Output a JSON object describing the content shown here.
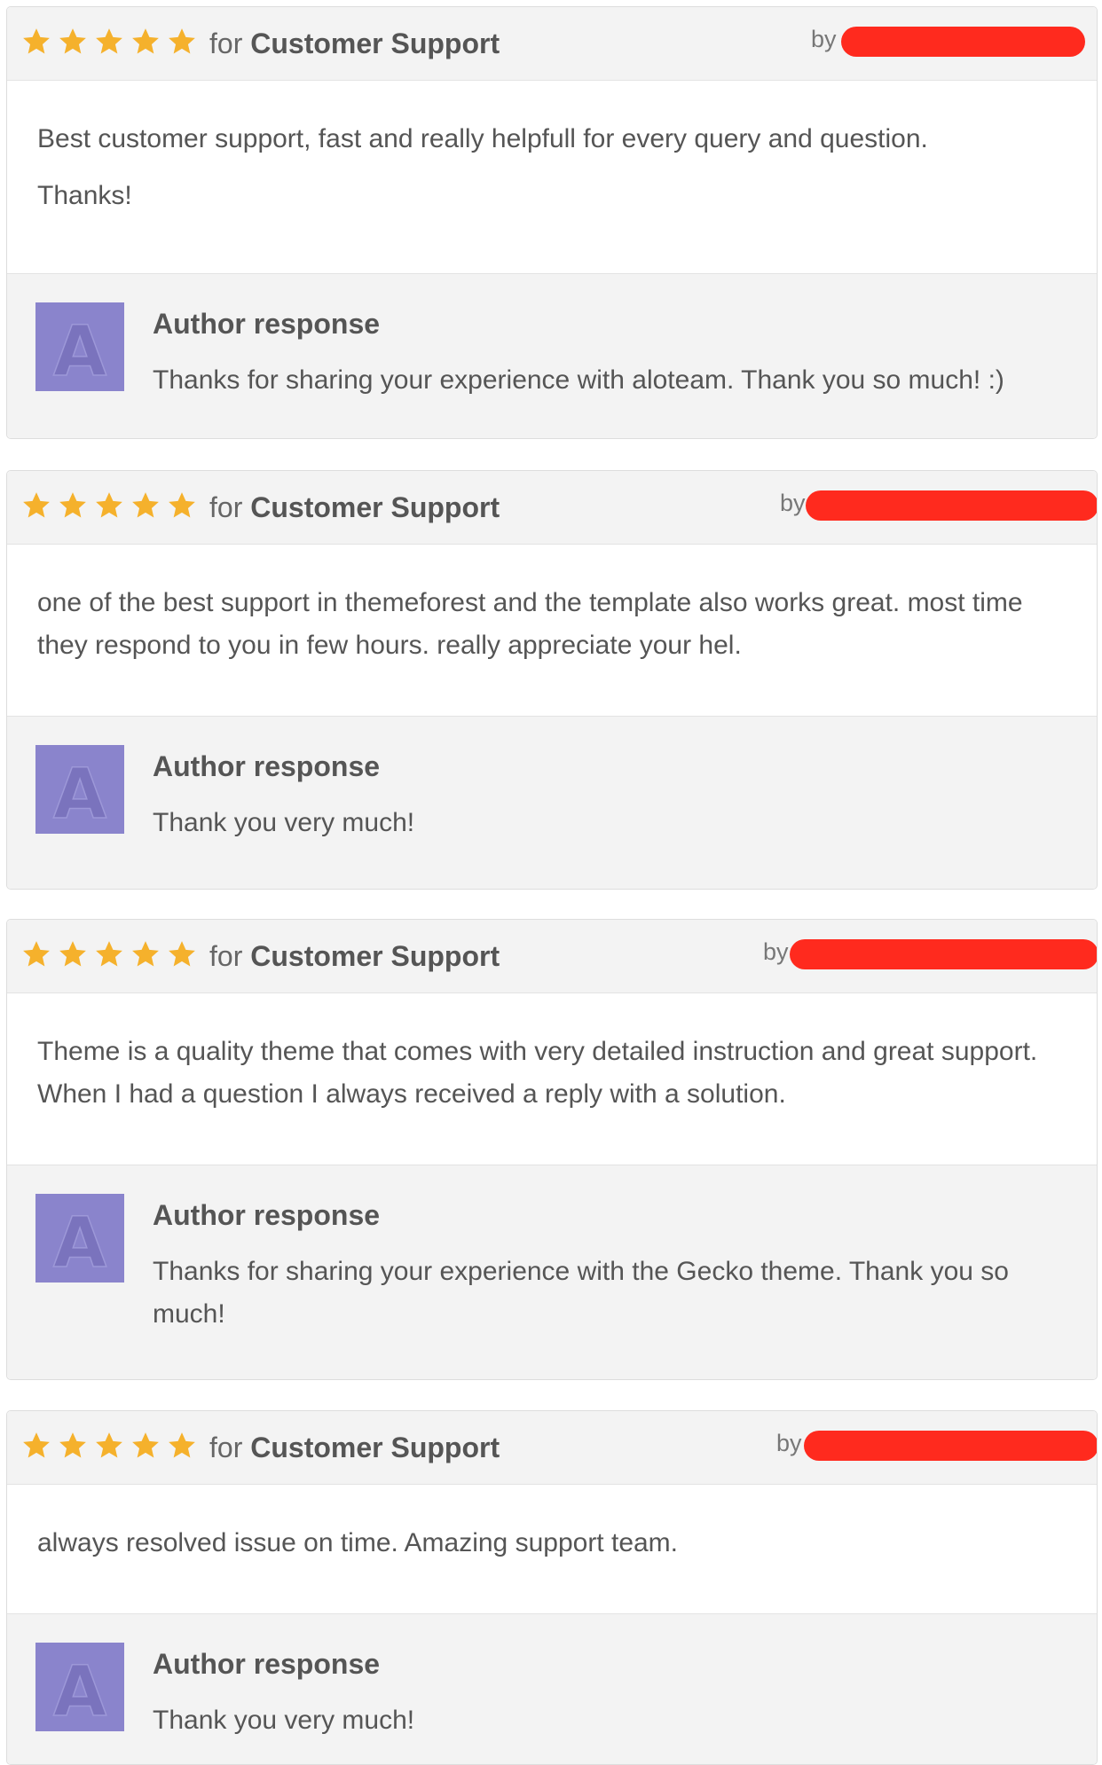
{
  "colors": {
    "star": "#f5b12c",
    "redaction": "#ff2a1e",
    "avatar": "#8a84cc"
  },
  "reviews": [
    {
      "rating": 5,
      "for_prefix": "for",
      "category": "Customer Support",
      "by_label": "by",
      "body": "Best customer support, fast and really helpfull for every query and question.",
      "body_extra": "Thanks!",
      "response_title": "Author response",
      "response_text": "Thanks for sharing your experience with aloteam. Thank you so much! :)",
      "avatar_letter": "A"
    },
    {
      "rating": 5,
      "for_prefix": "for",
      "category": "Customer Support",
      "by_label": "by",
      "body": "one of the best support in themeforest and the template also works great. most time they respond to you in few hours. really appreciate your hel.",
      "response_title": "Author response",
      "response_text": "Thank you very much!",
      "avatar_letter": "A"
    },
    {
      "rating": 5,
      "for_prefix": "for",
      "category": "Customer Support",
      "by_label": "by",
      "body": "Theme is a quality theme that comes with very detailed instruction and great support. When I had a question I always received a reply with a solution.",
      "response_title": "Author response",
      "response_text": "Thanks for sharing your experience with the Gecko theme. Thank you so much!",
      "avatar_letter": "A"
    },
    {
      "rating": 5,
      "for_prefix": "for",
      "category": "Customer Support",
      "by_label": "by",
      "body": "always resolved issue on time. Amazing support team.",
      "response_title": "Author response",
      "response_text": "Thank you very much!",
      "avatar_letter": "A"
    }
  ]
}
